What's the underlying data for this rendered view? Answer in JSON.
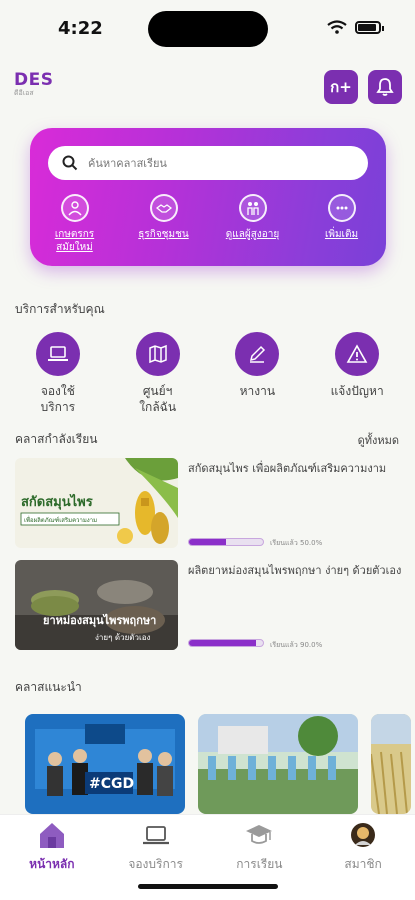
{
  "status_bar": {
    "time": "4:22"
  },
  "header": {
    "logo_text": "DES",
    "logo_sub": "ดีอีเอส",
    "add_button_label": "ก+",
    "bell_icon": "bell-icon"
  },
  "hero": {
    "search_placeholder": "ค้นหาคลาสเรียน",
    "categories": [
      {
        "label": "เกษตรกร\nสมัยใหม่",
        "icon": "farmer-icon"
      },
      {
        "label": "ธุรกิจชุมชน",
        "icon": "handshake-icon"
      },
      {
        "label": "ดูแลผู้สูงอายุ",
        "icon": "elderly-icon"
      },
      {
        "label": "เพิ่มเติม",
        "icon": "more-icon"
      }
    ]
  },
  "services": {
    "title": "บริการสำหรับคุณ",
    "items": [
      {
        "label": "จองใช้\nบริการ",
        "icon": "laptop-icon"
      },
      {
        "label": "ศูนย์ฯ\nใกล้ฉัน",
        "icon": "map-icon"
      },
      {
        "label": "หางาน",
        "icon": "pen-icon"
      },
      {
        "label": "แจ้งปัญหา",
        "icon": "warning-icon"
      }
    ]
  },
  "current_classes": {
    "title": "คลาสกำลังเรียน",
    "see_all": "ดูทั้งหมด",
    "items": [
      {
        "title": "สกัดสมุนไพร เพื่อผลิตภัณฑ์เสริมความงาม",
        "thumb_title": "สกัดสมุนไพร",
        "thumb_sub": "เพื่อผลิตภัณฑ์เสริมความงาม",
        "progress": 0.5,
        "progress_text": "เรียนแล้ว 50.0%"
      },
      {
        "title": "ผลิตยาหม่องสมุนไพรพฤกษา ง่ายๆ ด้วยตัวเอง",
        "thumb_title": "ยาหม่องสมุนไพรพฤกษา",
        "thumb_sub": "ง่ายๆ ด้วยตัวเอง",
        "progress": 0.9,
        "progress_text": "เรียนแล้ว 90.0%"
      }
    ]
  },
  "recommended": {
    "title": "คลาสแนะนำ",
    "items": [
      {
        "banner_text": "#CGD"
      },
      {
        "banner_text": ""
      },
      {
        "banner_text": ""
      }
    ]
  },
  "tabbar": {
    "tabs": [
      {
        "label": "หน้าหลัก",
        "icon": "home-icon",
        "active": true
      },
      {
        "label": "จองบริการ",
        "icon": "laptop-icon",
        "active": false
      },
      {
        "label": "การเรียน",
        "icon": "graduation-cap-icon",
        "active": false
      },
      {
        "label": "สมาชิก",
        "icon": "avatar-icon",
        "active": false
      }
    ]
  },
  "colors": {
    "primary": "#7b2fb0",
    "hero_gradient_start": "#d92bd8",
    "hero_gradient_end": "#7a40d8",
    "progress": "#8b2fc9",
    "background": "#f6f7f3"
  }
}
